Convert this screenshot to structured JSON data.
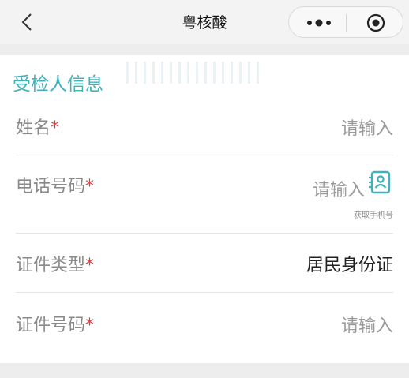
{
  "nav": {
    "title": "粤核酸"
  },
  "section": {
    "title": "受检人信息"
  },
  "fields": [
    {
      "label": "姓名",
      "required_mark": "*",
      "placeholder": "请输入"
    },
    {
      "label": "电话号码",
      "required_mark": "*",
      "placeholder": "请输入",
      "helper": "获取手机号",
      "icon": "contact-card-icon"
    },
    {
      "label": "证件类型",
      "required_mark": "*",
      "value": "居民身份证"
    },
    {
      "label": "证件号码",
      "required_mark": "*",
      "placeholder": "请输入"
    }
  ],
  "colors": {
    "accent": "#3fb3ba",
    "required": "#e23b3b"
  }
}
